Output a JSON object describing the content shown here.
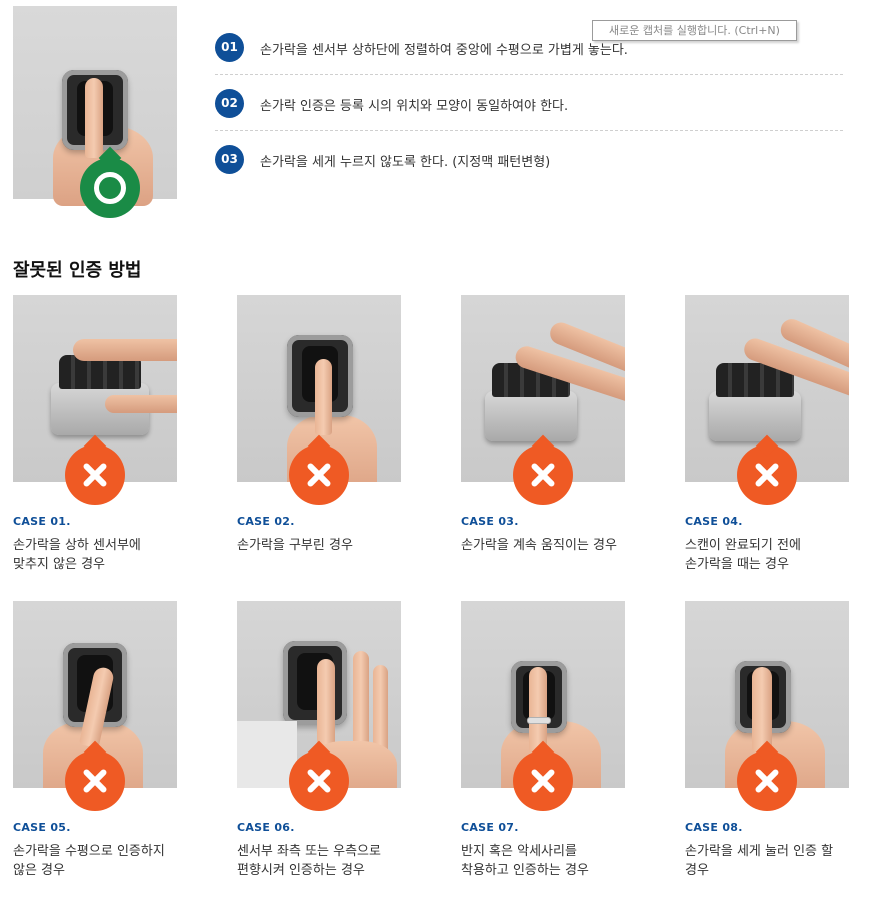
{
  "tooltip": "새로운 캡처를 실행합니다. (Ctrl+N)",
  "steps": [
    {
      "num": "01",
      "text": "손가락을 센서부 상하단에 정렬하여 중앙에 수평으로 가볍게 놓는다."
    },
    {
      "num": "02",
      "text": "손가락 인증은 등록 시의 위치와 모양이 동일하여야 한다."
    },
    {
      "num": "03",
      "text": "손가락을 세게 누르지 않도록 한다. (지정맥 패턴변형)"
    }
  ],
  "section_title": "잘못된 인증 방법",
  "colors": {
    "primary": "#0f4f98",
    "ok": "#1a8b46",
    "error": "#ef5a24"
  },
  "cases": [
    {
      "label": "CASE 01.",
      "line1": "손가락을 상하 센서부에",
      "line2": "맞추지 않은 경우",
      "icon": "x-icon"
    },
    {
      "label": "CASE 02.",
      "line1": "손가락을 구부린 경우",
      "line2": "",
      "icon": "x-icon"
    },
    {
      "label": "CASE 03.",
      "line1": "손가락을 계속 움직이는 경우",
      "line2": "",
      "icon": "x-icon"
    },
    {
      "label": "CASE 04.",
      "line1": "스캔이 완료되기 전에",
      "line2": "손가락을 때는 경우",
      "icon": "x-icon"
    },
    {
      "label": "CASE 05.",
      "line1": "손가락을 수평으로 인증하지",
      "line2": "않은 경우",
      "icon": "x-icon"
    },
    {
      "label": "CASE 06.",
      "line1": "센서부 좌측 또는 우측으로",
      "line2": "편향시켜 인증하는 경우",
      "icon": "x-icon"
    },
    {
      "label": "CASE 07.",
      "line1": "반지 혹은 악세사리를",
      "line2": "착용하고 인증하는 경우",
      "icon": "x-icon"
    },
    {
      "label": "CASE 08.",
      "line1": "손가락을 세게 눌러 인증 할",
      "line2": "경우",
      "icon": "x-icon"
    }
  ]
}
